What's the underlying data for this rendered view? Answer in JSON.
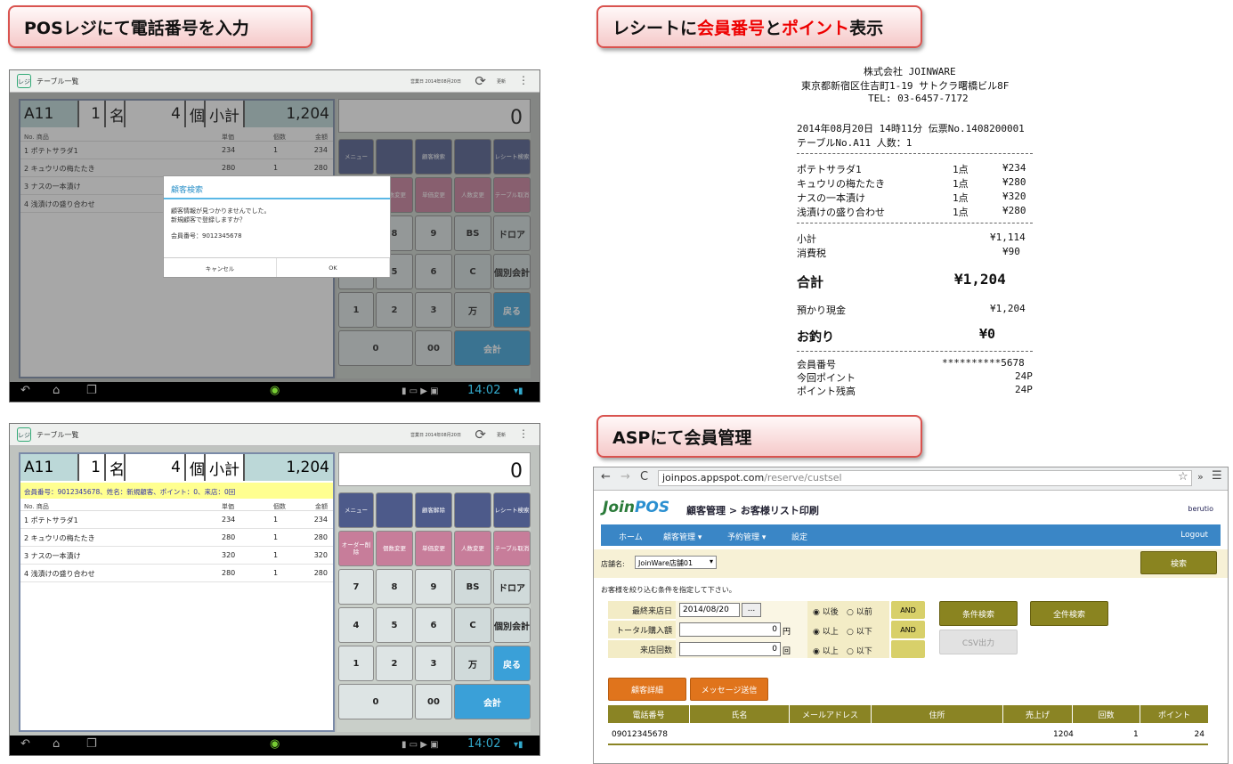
{
  "labels": {
    "l1": "POSレジにて電話番号を入力",
    "l2a": "レシートに",
    "l2b": "会員番号",
    "l2c": "と",
    "l2d": "ポイント",
    "l2e": "表示",
    "l3": "ASPにて会員管理"
  },
  "pos": {
    "app_icon": "レジ",
    "title": "テーブル一覧",
    "date": "営業日 2014年08月20日",
    "update": "更新",
    "table": "A11",
    "people": "1",
    "people_unit": "名",
    "items": "4",
    "items_unit": "個",
    "subtotal_label": "小計",
    "subtotal": "1,204",
    "display": "0",
    "cols": [
      "No. 商品",
      "単価",
      "個数",
      "金額"
    ],
    "rows": [
      [
        "1  ポテトサラダ1",
        "234",
        "1",
        "234"
      ],
      [
        "2  キュウリの梅たたき",
        "280",
        "1",
        "280"
      ],
      [
        "3  ナスの一本漬け",
        "320",
        "1",
        "320"
      ],
      [
        "4  浅漬けの盛り合わせ",
        "280",
        "1",
        "280"
      ]
    ],
    "notice": "会員番号：9012345678、姓名：新規顧客、ポイント：0、来店：0回",
    "keys": {
      "menu": "メニュー",
      "search": "顧客検索",
      "release": "顧客解除",
      "receipt": "レシート検索",
      "order_del": "オーダー削除",
      "qty": "個数変更",
      "price": "単価変更",
      "ppl": "人数変更",
      "tbl_cancel": "テーブル取消",
      "k7": "7",
      "k8": "8",
      "k9": "9",
      "bs": "BS",
      "drawer": "ドロア",
      "k4": "4",
      "k5": "5",
      "k6": "6",
      "c": "C",
      "split": "個別会計",
      "k1": "1",
      "k2": "2",
      "k3": "3",
      "man": "万",
      "back": "戻る",
      "k0": "0",
      "k00": "00",
      "total": "会計"
    },
    "time": "14:02",
    "dialog": {
      "title": "顧客検索",
      "msg1": "顧客情報が見つかりませんでした。",
      "msg2": "新規顧客で登録しますか？",
      "num": "会員番号：9012345678",
      "cancel": "キャンセル",
      "ok": "OK"
    }
  },
  "receipt": {
    "company": "株式会社 JOINWARE",
    "addr": "東京都新宿区住吉町1-19 サトクラ曙橋ビル8F",
    "tel": "TEL: 03-6457-7172",
    "dt": "2014年08月20日 14時11分  伝票No.1408200001",
    "tbl": "テーブルNo.A11 人数：1",
    "items": [
      [
        "ポテトサラダ1",
        "1点",
        "¥234"
      ],
      [
        "キュウリの梅たたき",
        "1点",
        "¥280"
      ],
      [
        "ナスの一本漬け",
        "1点",
        "¥320"
      ],
      [
        "浅漬けの盛り合わせ",
        "1点",
        "¥280"
      ]
    ],
    "sub_l": "小計",
    "sub_v": "¥1,114",
    "tax_l": "消費税",
    "tax_v": "¥90",
    "tot_l": "合計",
    "tot_v": "¥1,204",
    "dep_l": "預かり現金",
    "dep_v": "¥1,204",
    "chg_l": "お釣り",
    "chg_v": "¥0",
    "mem_l": "会員番号",
    "mem_v": "**********5678",
    "pt_l": "今回ポイント",
    "pt_v": "24P",
    "bal_l": "ポイント残高",
    "bal_v": "24P"
  },
  "asp": {
    "url_host": "joinpos.appspot.com",
    "url_path": "/reserve/custsel",
    "logo_a": "Join",
    "logo_b": "POS",
    "crumb": "顧客管理 > お客様リスト印刷",
    "user": "berutio",
    "nav": [
      "ホーム",
      "顧客管理 ▾",
      "予約管理 ▾",
      "設定"
    ],
    "logout": "Logout",
    "store_l": "店舗名:",
    "store_v": "JoinWare店舗01",
    "search": "検索",
    "hint": "お客様を絞り込む条件を指定して下さい。",
    "f1": "最終来店日",
    "f1v": "2014/08/20",
    "f1b": "...",
    "f2": "トータル購入額",
    "f2v": "0",
    "f2u": "円",
    "f3": "来店回数",
    "f3v": "0",
    "f3u": "回",
    "r1a": "◉ 以後",
    "r1b": "○ 以前",
    "r2a": "◉ 以上",
    "r2b": "○ 以下",
    "r3a": "◉ 以上",
    "r3b": "○ 以下",
    "and": "AND",
    "cond": "条件検索",
    "all": "全件検索",
    "csv": "CSV出力",
    "detail": "顧客詳細",
    "msg": "メッセージ送信",
    "cols": [
      "電話番号",
      "氏名",
      "メールアドレス",
      "住所",
      "売上げ",
      "回数",
      "ポイント"
    ],
    "row": [
      "09012345678",
      "",
      "",
      "",
      "1204",
      "1",
      "24"
    ]
  }
}
